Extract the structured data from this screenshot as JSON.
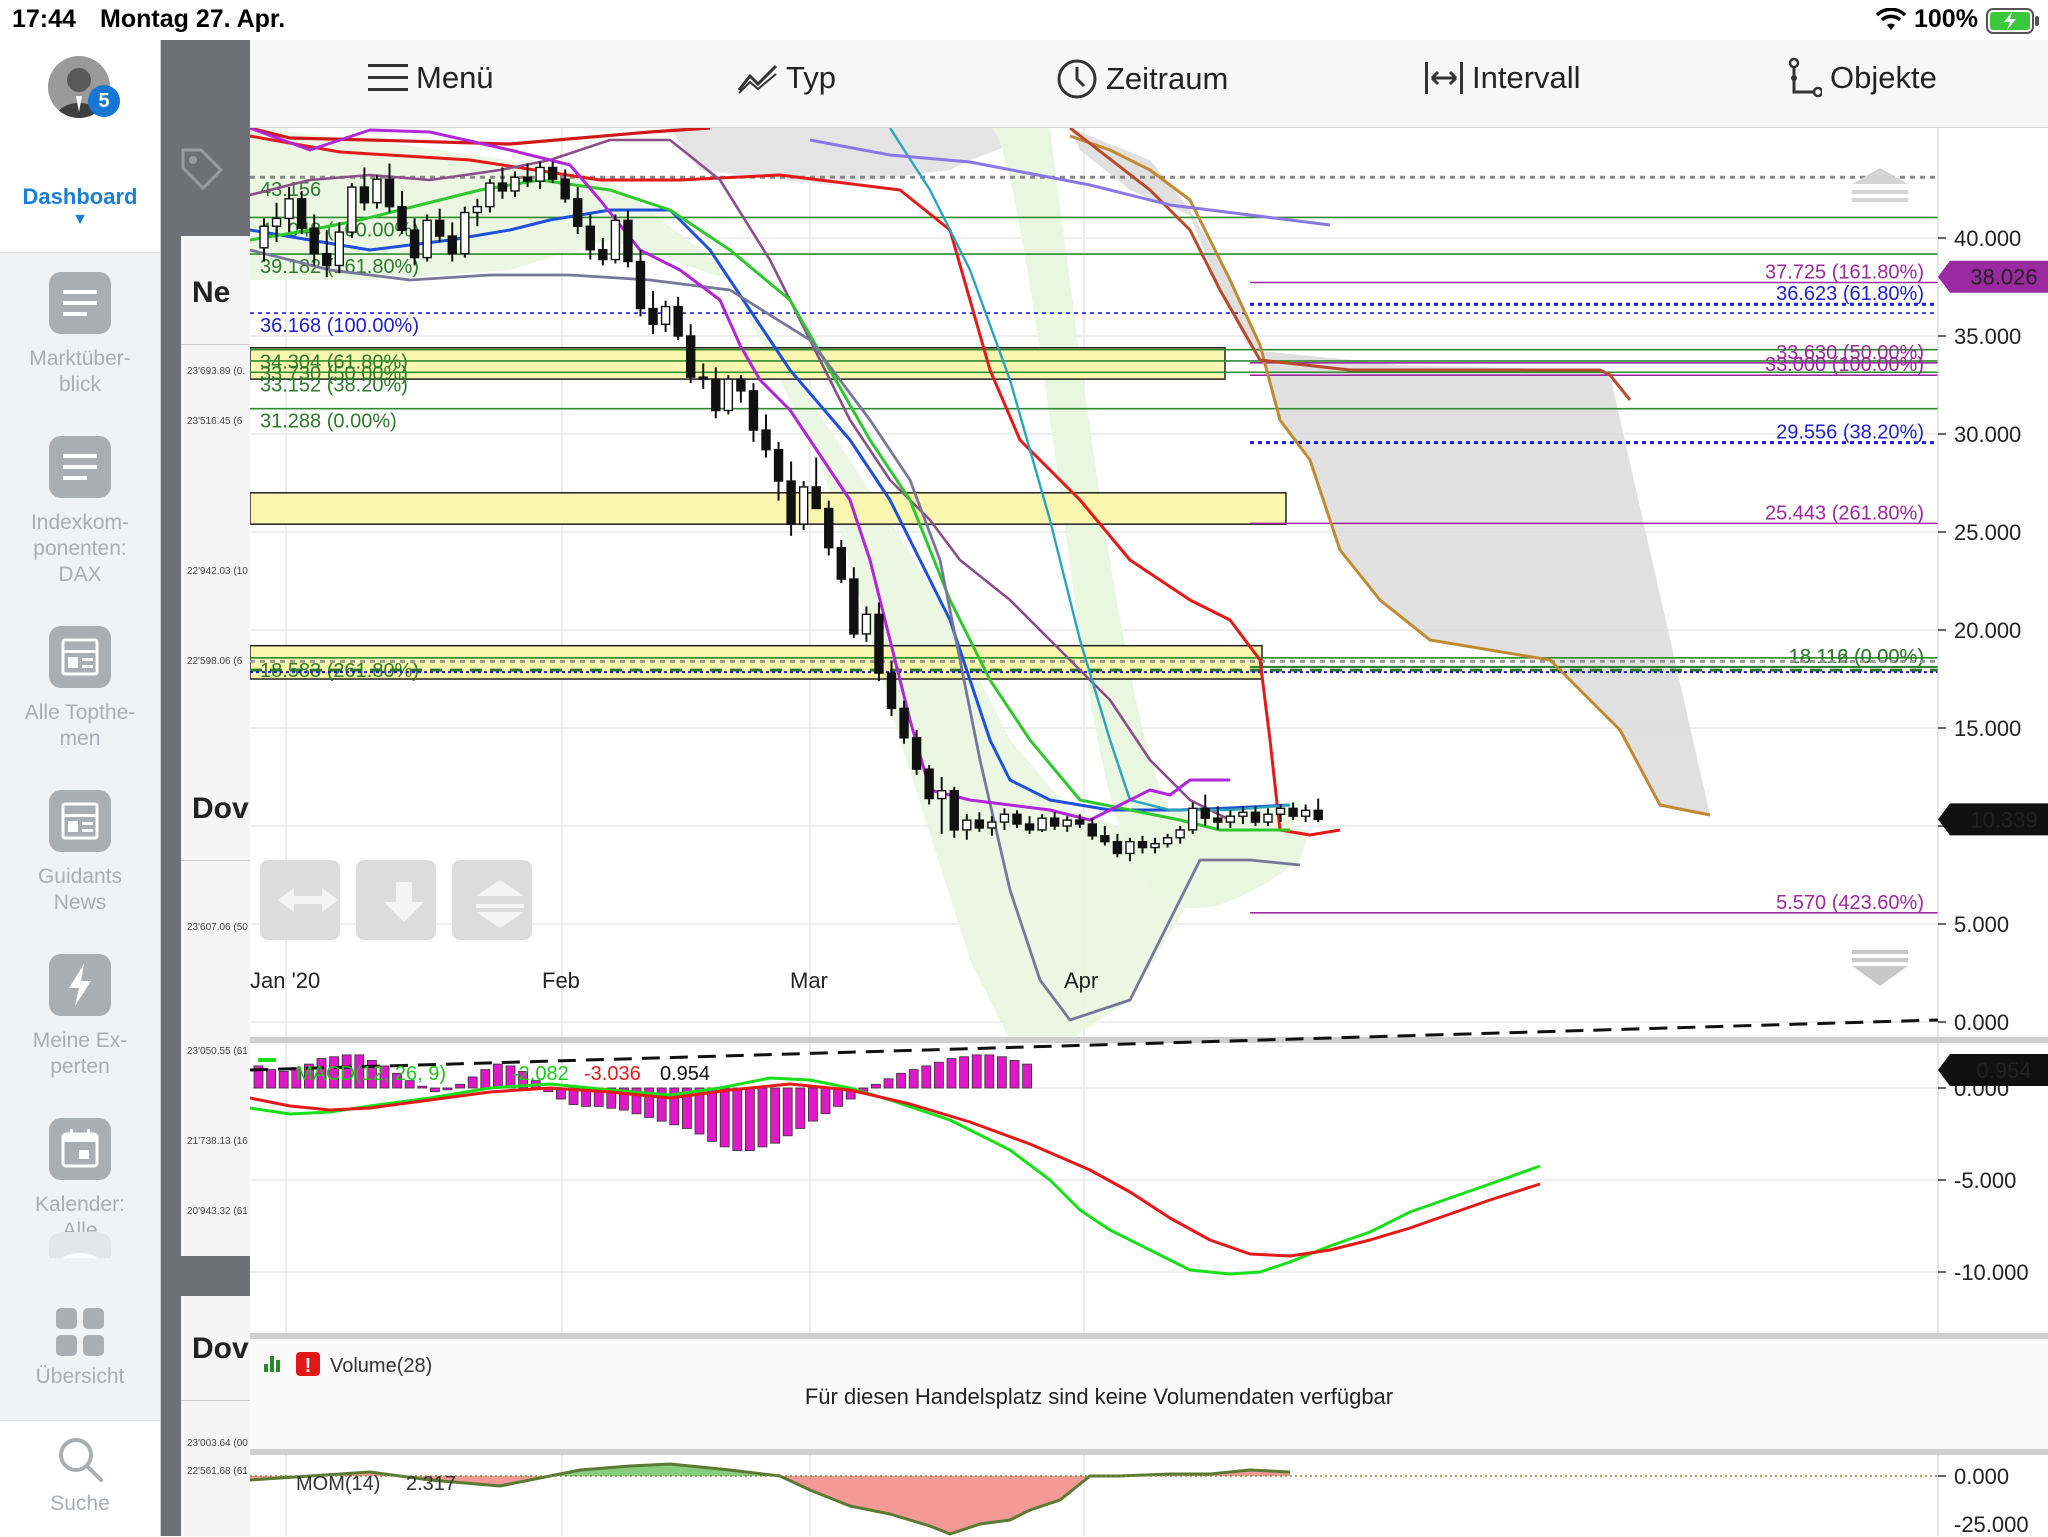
{
  "status_bar": {
    "time": "17:44",
    "date": "Montag 27. Apr.",
    "battery": "100%",
    "icons": [
      "wifi-icon",
      "battery-charging-icon"
    ]
  },
  "sidebar": {
    "badge_count": "5",
    "dashboard_label": "Dashboard",
    "dashboard_arrow": "▼",
    "items": [
      {
        "label_lines": [
          "Marktüber-",
          "blick"
        ],
        "icon": "list-icon"
      },
      {
        "label_lines": [
          "Indexkom-",
          "ponenten:",
          "DAX"
        ],
        "icon": "list-icon"
      },
      {
        "label_lines": [
          "Alle Topthe-",
          "men"
        ],
        "icon": "news-icon"
      },
      {
        "label_lines": [
          "Guidants",
          "News"
        ],
        "icon": "news-icon"
      },
      {
        "label_lines": [
          "Meine Ex-",
          "perten"
        ],
        "icon": "lightning-icon"
      },
      {
        "label_lines": [
          "Kalender:",
          "Alle"
        ],
        "icon": "calendar-icon"
      }
    ],
    "overview_label": "Übersicht",
    "search_label": "Suche"
  },
  "toolbar": {
    "menu": "Menü",
    "type": "Typ",
    "period": "Zeitraum",
    "interval": "Intervall",
    "objects": "Objekte"
  },
  "background_panel": {
    "title_fragments": [
      "Ne",
      "Dov",
      "Dov"
    ],
    "small_values": [
      "23'693.89 (0.",
      "23'516.45 (6",
      "22'942.03 (10",
      "22'598.06 (6",
      "23'607.06 (50",
      "23'050.55 (61",
      "21'738.13 (16",
      "20'943.32 (61",
      "23'003.64 (00",
      "22'561.68 (61"
    ]
  },
  "chart_data": {
    "type": "candlestick",
    "x_axis_labels": [
      "Jan '20",
      "Feb",
      "Mar",
      "Apr"
    ],
    "y_axis": {
      "ylim": [
        0,
        43
      ],
      "ticks": [
        "40.000",
        "35.000",
        "30.000",
        "25.000",
        "20.000",
        "15.000",
        "10.000",
        "5.000",
        "0.000"
      ]
    },
    "last_price": "10.339",
    "last_price_purple": "38.026",
    "candles": [
      [
        39.5,
        41.0,
        38.8,
        40.6
      ],
      [
        40.6,
        41.8,
        39.8,
        41.0
      ],
      [
        41.0,
        42.6,
        40.3,
        42.0
      ],
      [
        42.0,
        42.4,
        40.2,
        40.5
      ],
      [
        40.5,
        41.2,
        38.6,
        39.2
      ],
      [
        39.2,
        40.4,
        38.0,
        38.6
      ],
      [
        38.6,
        40.8,
        38.2,
        40.3
      ],
      [
        40.3,
        42.8,
        40.0,
        42.6
      ],
      [
        42.6,
        43.6,
        41.4,
        41.8
      ],
      [
        41.8,
        43.2,
        41.5,
        43.0
      ],
      [
        43.0,
        43.8,
        41.3,
        41.6
      ],
      [
        41.6,
        42.4,
        40.2,
        40.4
      ],
      [
        40.4,
        41.0,
        38.6,
        39.0
      ],
      [
        39.0,
        41.2,
        38.8,
        40.9
      ],
      [
        40.9,
        41.5,
        39.8,
        40.1
      ],
      [
        40.1,
        40.8,
        38.8,
        39.2
      ],
      [
        39.2,
        41.6,
        39.0,
        41.3
      ],
      [
        41.3,
        42.0,
        40.6,
        41.6
      ],
      [
        41.6,
        43.0,
        41.3,
        42.8
      ],
      [
        42.8,
        43.6,
        42.0,
        42.4
      ],
      [
        42.4,
        43.4,
        42.1,
        43.1
      ],
      [
        43.1,
        43.8,
        42.6,
        42.9
      ],
      [
        42.9,
        43.9,
        42.5,
        43.6
      ],
      [
        43.6,
        43.9,
        42.8,
        43.0
      ],
      [
        43.0,
        43.5,
        41.8,
        42.0
      ],
      [
        42.0,
        42.6,
        40.2,
        40.6
      ],
      [
        40.6,
        41.2,
        38.9,
        39.4
      ],
      [
        39.4,
        40.0,
        38.6,
        38.9
      ],
      [
        38.9,
        41.2,
        38.7,
        40.9
      ],
      [
        40.9,
        41.4,
        38.5,
        38.8
      ],
      [
        38.8,
        39.4,
        36.0,
        36.4
      ],
      [
        36.4,
        37.3,
        35.1,
        35.6
      ],
      [
        35.6,
        36.8,
        35.2,
        36.5
      ],
      [
        36.5,
        37.0,
        34.8,
        35.0
      ],
      [
        35.0,
        35.6,
        32.6,
        32.9
      ],
      [
        32.9,
        33.6,
        32.3,
        32.8
      ],
      [
        32.8,
        33.4,
        30.8,
        31.2
      ],
      [
        31.2,
        33.0,
        31.0,
        32.8
      ],
      [
        32.8,
        33.0,
        31.6,
        32.2
      ],
      [
        32.2,
        32.6,
        29.6,
        30.2
      ],
      [
        30.2,
        31.0,
        28.8,
        29.2
      ],
      [
        29.2,
        29.6,
        26.6,
        27.6
      ],
      [
        27.6,
        28.6,
        24.8,
        25.4
      ],
      [
        25.4,
        27.6,
        25.1,
        27.3
      ],
      [
        27.3,
        28.8,
        26.8,
        26.2
      ],
      [
        26.2,
        26.6,
        23.8,
        24.2
      ],
      [
        24.2,
        24.6,
        22.4,
        22.6
      ],
      [
        22.6,
        23.2,
        19.6,
        19.8
      ],
      [
        19.8,
        21.2,
        19.4,
        20.8
      ],
      [
        20.8,
        21.4,
        17.4,
        17.8
      ],
      [
        17.8,
        18.4,
        15.6,
        16.0
      ],
      [
        16.0,
        16.4,
        14.2,
        14.5
      ],
      [
        14.5,
        14.9,
        12.6,
        12.9
      ],
      [
        12.9,
        13.1,
        11.1,
        11.4
      ],
      [
        11.4,
        12.5,
        9.6,
        11.8
      ],
      [
        11.8,
        12.0,
        9.4,
        9.8
      ],
      [
        9.8,
        10.6,
        9.3,
        10.3
      ],
      [
        10.3,
        10.7,
        9.7,
        9.9
      ],
      [
        9.9,
        10.5,
        9.5,
        10.2
      ],
      [
        10.2,
        10.9,
        9.8,
        10.6
      ],
      [
        10.6,
        10.8,
        9.9,
        10.1
      ],
      [
        10.1,
        10.5,
        9.6,
        9.8
      ],
      [
        9.8,
        10.6,
        9.7,
        10.4
      ],
      [
        10.4,
        10.7,
        9.8,
        10.0
      ],
      [
        10.0,
        10.5,
        9.7,
        10.3
      ],
      [
        10.3,
        10.6,
        9.9,
        10.1
      ],
      [
        10.1,
        10.4,
        9.3,
        9.5
      ],
      [
        9.5,
        10.0,
        9.0,
        9.2
      ],
      [
        9.2,
        9.6,
        8.4,
        8.6
      ],
      [
        8.6,
        9.4,
        8.2,
        9.2
      ],
      [
        9.2,
        9.5,
        8.6,
        8.9
      ],
      [
        8.9,
        9.4,
        8.6,
        9.1
      ],
      [
        9.1,
        9.6,
        8.9,
        9.4
      ],
      [
        9.4,
        10.0,
        9.1,
        9.8
      ],
      [
        9.8,
        11.2,
        9.6,
        10.9
      ],
      [
        10.9,
        11.6,
        10.0,
        10.4
      ],
      [
        10.4,
        11.0,
        9.8,
        10.2
      ],
      [
        10.2,
        10.8,
        9.9,
        10.5
      ],
      [
        10.5,
        11.0,
        10.1,
        10.7
      ],
      [
        10.7,
        11.0,
        10.0,
        10.2
      ],
      [
        10.2,
        10.9,
        10.0,
        10.6
      ],
      [
        10.6,
        11.1,
        10.2,
        10.9
      ],
      [
        10.9,
        11.2,
        10.3,
        10.5
      ],
      [
        10.5,
        11.1,
        10.2,
        10.8
      ],
      [
        10.8,
        11.4,
        10.2,
        10.339
      ]
    ],
    "fib_left": [
      {
        "label": "43.156",
        "value": 43.1
      },
      {
        "label": "41.048 (100.00%)",
        "value": 41.05
      },
      {
        "label": "39.182 (161.80%)",
        "value": 39.18
      },
      {
        "label": "36.168 (100.00%)",
        "value": 36.17
      },
      {
        "label": "34.304 (61.80%)",
        "value": 34.3
      },
      {
        "label": "33.730 (50.00%)",
        "value": 33.73
      },
      {
        "label": "33.152 (38.20%)",
        "value": 33.15
      },
      {
        "label": "31.288 (0.00%)",
        "value": 31.29
      },
      {
        "label": "18.583 (261.80%)",
        "value": 18.58
      }
    ],
    "fib_right": [
      {
        "label": "37.725 (161.80%)",
        "value": 37.73
      },
      {
        "label": "36.623 (61.80%)",
        "value": 36.62
      },
      {
        "label": "33.630 (50.00%)",
        "value": 33.63
      },
      {
        "label": "33.000 (100.00%)",
        "value": 33.0
      },
      {
        "label": "29.556 (38.20%)",
        "value": 29.56
      },
      {
        "label": "25.443 (261.80%)",
        "value": 25.44
      },
      {
        "label": "18.116 (0.00%)",
        "value": 18.12
      },
      {
        "label": "18.112 (0.00%)",
        "value": 18.11
      },
      {
        "label": "5.570 (423.60%)",
        "value": 5.57
      }
    ],
    "zones": [
      {
        "from": 32.8,
        "to": 34.4
      },
      {
        "from": 25.4,
        "to": 27.0
      },
      {
        "from": 17.5,
        "to": 19.2
      }
    ],
    "macd": {
      "label": "MACD(12, 26, 9)",
      "macd_value": "-2.082",
      "signal_value": "-3.036",
      "hist_value": "0.954",
      "last_value": "0.954",
      "y_ticks": [
        "0.000",
        "-5.000",
        "-10.000"
      ]
    },
    "volume": {
      "label": "Volume(28)",
      "message": "Für diesen Handelsplatz sind keine Volumendaten verfügbar"
    },
    "momentum": {
      "label": "MOM(14)",
      "value": "2.317",
      "y_ticks": [
        "0.000",
        "-25.000"
      ]
    }
  }
}
